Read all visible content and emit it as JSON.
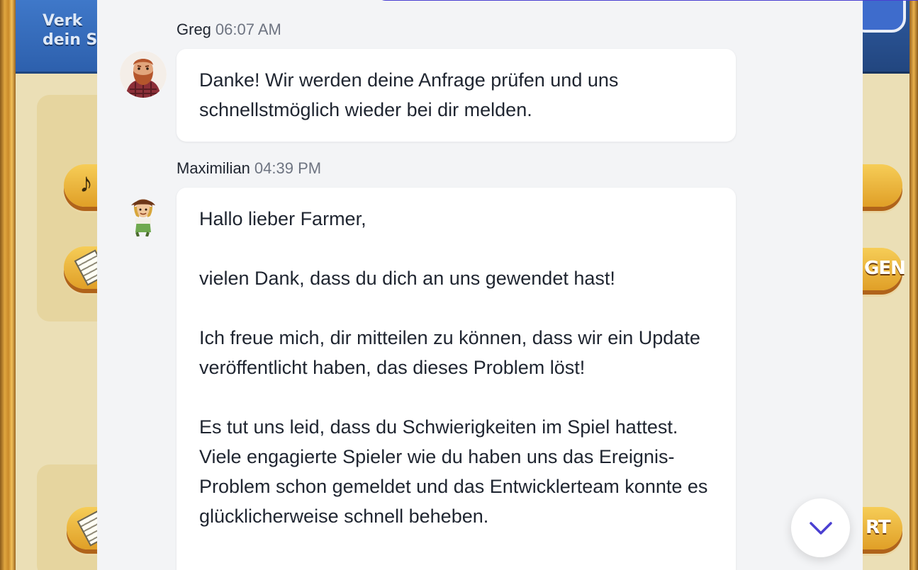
{
  "background": {
    "banner_text": "Verk dein S",
    "right_button_texts": [
      "GEN",
      "RT"
    ]
  },
  "chat": {
    "messages": [
      {
        "sender": "Greg",
        "time": "06:07 AM",
        "avatar": "greg-avatar",
        "paragraphs": [
          "Danke! Wir werden deine Anfrage prüfen und uns schnellstmöglich wieder bei dir melden."
        ]
      },
      {
        "sender": "Maximilian",
        "time": "04:39 PM",
        "avatar": "maximilian-avatar",
        "paragraphs": [
          "Hallo lieber Farmer,",
          "vielen Dank, dass du dich an uns gewendet hast!",
          "Ich freue mich, dir mitteilen zu können, dass wir ein Up­date veröffentlicht haben, das dieses Problem löst!",
          "Es tut uns leid, dass du Schwierigkeiten im Spiel hat­test. Viele engagierte Spieler wie du haben uns das Er­eignis-Problem schon gemeldet und das Entwickler­team konnte es glücklicherweise schnell beheben."
        ]
      }
    ],
    "scroll_button_icon": "chevron-down-icon",
    "colors": {
      "accent": "#4a3fd1",
      "panel_bg": "#f3f4f6",
      "bubble_bg": "#ffffff"
    }
  }
}
